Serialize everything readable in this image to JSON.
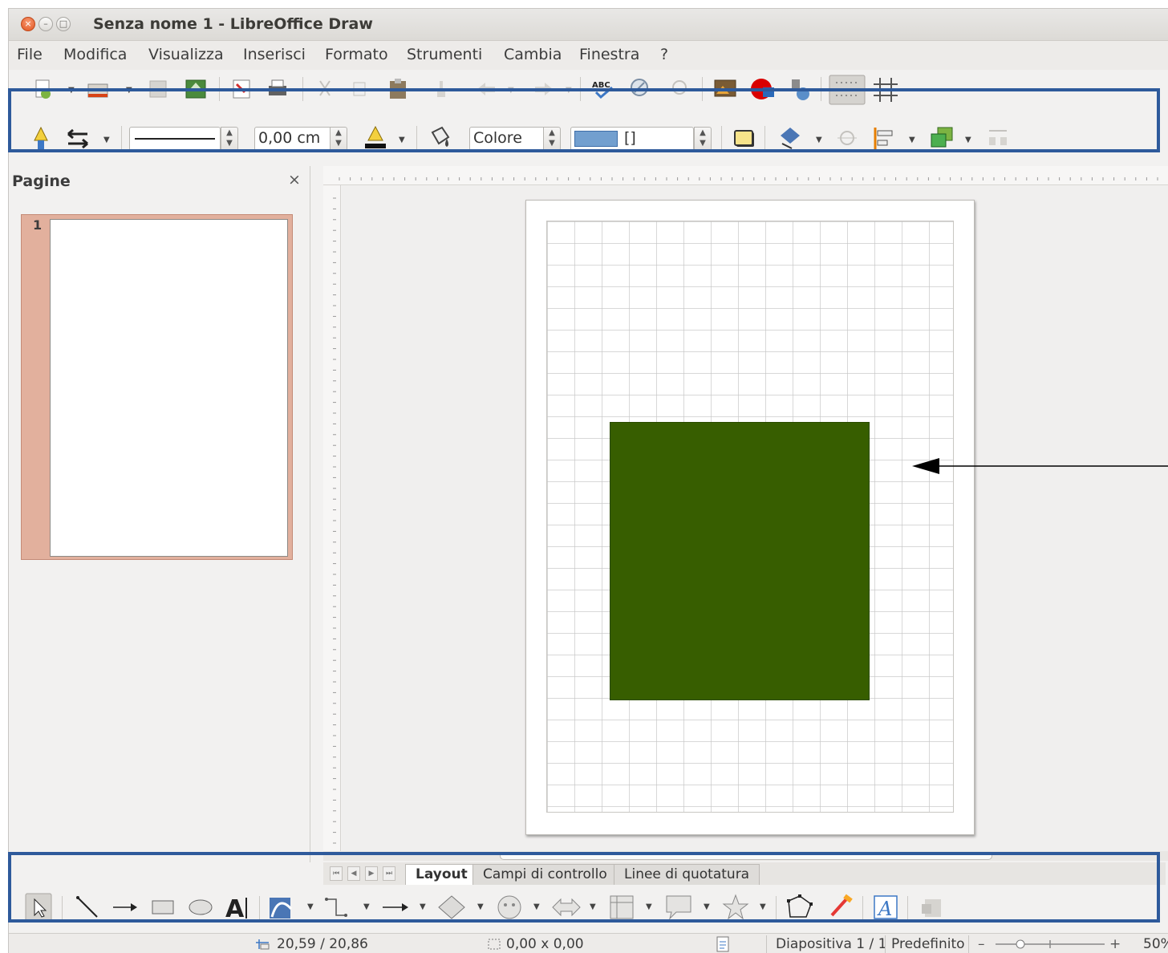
{
  "window": {
    "title": "Senza nome 1 - LibreOffice Draw",
    "close_glyph": "×",
    "min_glyph": "–",
    "max_glyph": "□"
  },
  "menu": {
    "items": [
      "File",
      "Modifica",
      "Visualizza",
      "Inserisci",
      "Formato",
      "Strumenti",
      "Cambia",
      "Finestra",
      "?"
    ]
  },
  "line_toolbar": {
    "line_width_value": "0,00 cm",
    "area_style_value": "Colore",
    "area_fill_value": "[]",
    "fill_color": "#729fcf"
  },
  "sidebar": {
    "title": "Pagine",
    "close_glyph": "×",
    "pages": [
      {
        "number": "1"
      }
    ]
  },
  "tabs": {
    "items": [
      {
        "label": "Layout",
        "active": true
      },
      {
        "label": "Campi di controllo",
        "active": false
      },
      {
        "label": "Linee di quotatura",
        "active": false
      }
    ]
  },
  "status": {
    "position": "20,59 / 20,86",
    "size": "0,00 x 0,00",
    "slide": "Diapositiva 1 / 1",
    "master": "Predefinito",
    "zoom": "50%",
    "zoom_minus": "–",
    "zoom_plus": "+"
  },
  "colors": {
    "shape_fill": "#375e00",
    "highlight_border": "#2e5a9b",
    "thumb_frame": "#e2b09d"
  }
}
